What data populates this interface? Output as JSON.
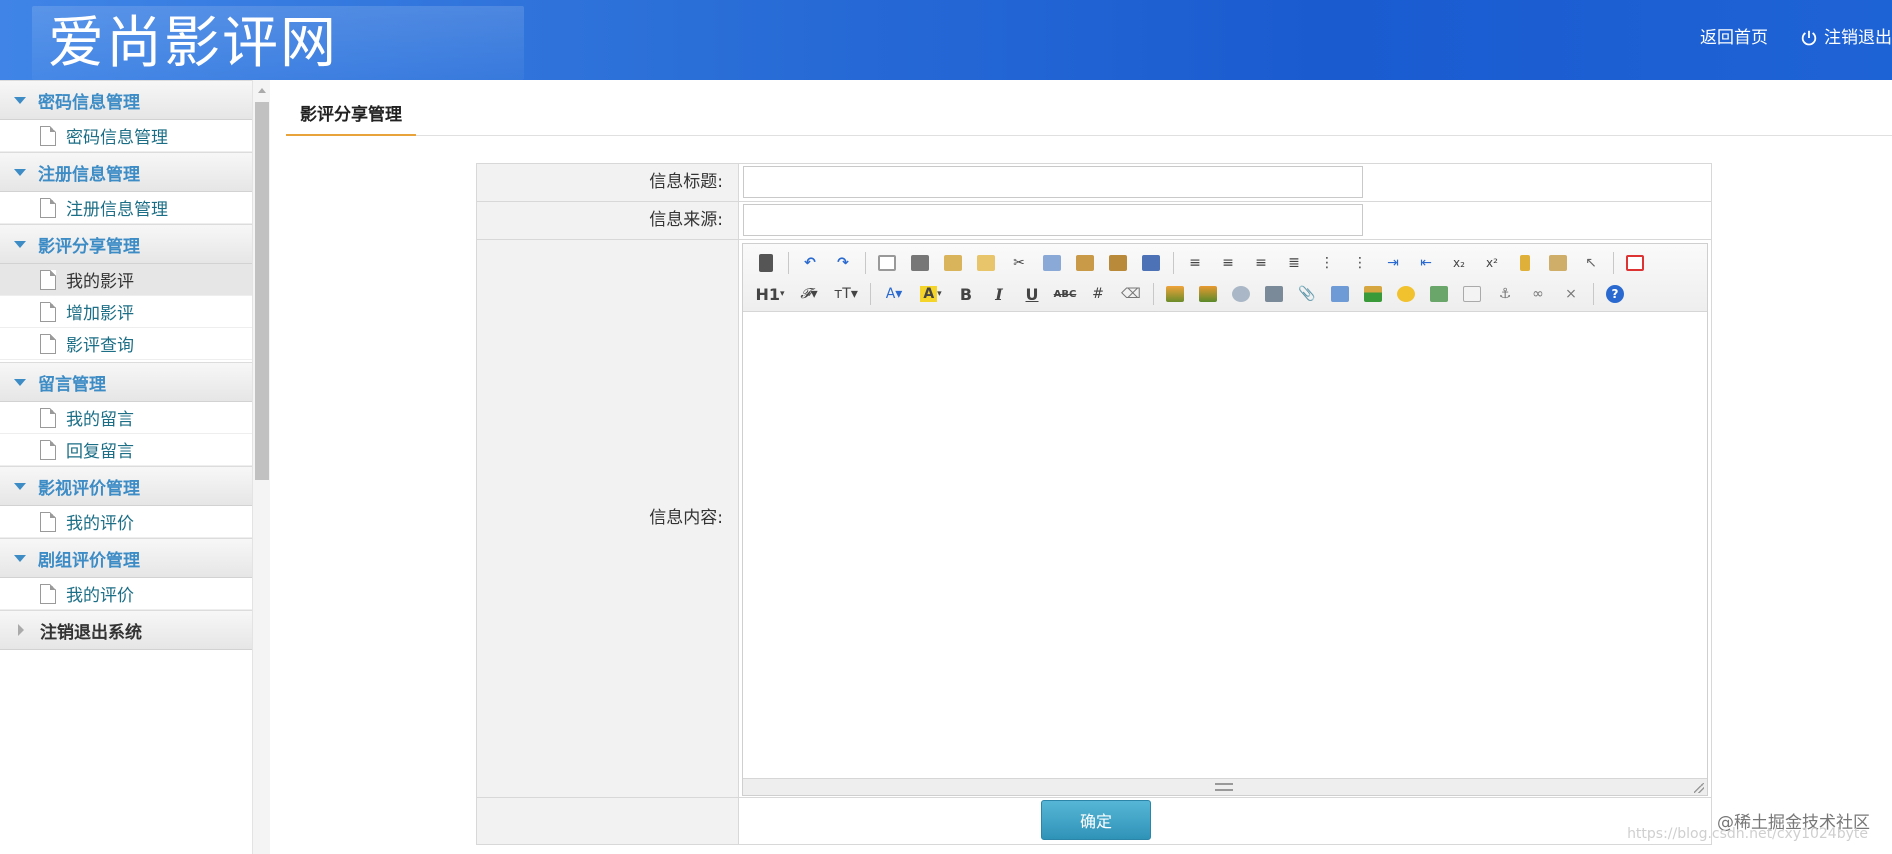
{
  "header": {
    "logo_text": "爱尚影评网",
    "nav_home": "返回首页",
    "nav_logout": "注销退出",
    "gradient_colors": [
      "#3f84e6",
      "#1a5bd0"
    ]
  },
  "sidebar": {
    "groups": [
      {
        "title": "密码信息管理",
        "items": [
          {
            "label": "密码信息管理"
          }
        ]
      },
      {
        "title": "注册信息管理",
        "items": [
          {
            "label": "注册信息管理"
          }
        ]
      },
      {
        "title": "影评分享管理",
        "items": [
          {
            "label": "我的影评",
            "active": true
          },
          {
            "label": "增加影评"
          },
          {
            "label": "影评查询"
          }
        ]
      },
      {
        "title": "留言管理",
        "items": [
          {
            "label": "我的留言"
          },
          {
            "label": "回复留言"
          }
        ]
      },
      {
        "title": "影视评价管理",
        "items": [
          {
            "label": "我的评价"
          }
        ]
      },
      {
        "title": "剧组评价管理",
        "items": [
          {
            "label": "我的评价"
          }
        ]
      },
      {
        "title": "注销退出系统",
        "items": []
      }
    ],
    "accent_color": "#3d8cc6"
  },
  "main": {
    "tab_label": "影评分享管理",
    "form": {
      "title_label": "信息标题:",
      "title_value": "",
      "source_label": "信息来源:",
      "source_value": "",
      "content_label": "信息内容:",
      "submit_label": "确定"
    },
    "editor_toolbar": {
      "row1": [
        "source-icon",
        "undo-icon",
        "redo-icon",
        "preview-icon",
        "print-icon",
        "template-icon",
        "code-icon",
        "cut-icon",
        "copy-icon",
        "paste-icon",
        "paste-text-icon",
        "paste-word-icon",
        "align-left-icon",
        "align-center-icon",
        "align-right-icon",
        "align-justify-icon",
        "ordered-list-icon",
        "unordered-list-icon",
        "indent-icon",
        "outdent-icon",
        "subscript-icon",
        "superscript-icon",
        "clear-format-icon",
        "quick-format-icon",
        "select-all-icon",
        "fullscreen-icon"
      ],
      "row2": [
        "heading-icon",
        "font-family-icon",
        "font-size-icon",
        "font-color-icon",
        "highlight-icon",
        "bold-icon",
        "italic-icon",
        "underline-icon",
        "strikethrough-icon",
        "line-height-icon",
        "remove-format-icon",
        "image-icon",
        "multi-image-icon",
        "flash-icon",
        "media-icon",
        "attachment-icon",
        "table-icon",
        "horizontal-rule-icon",
        "emoticon-icon",
        "map-icon",
        "page-break-icon",
        "anchor-icon",
        "link-icon",
        "unlink-icon",
        "help-icon"
      ],
      "heading_text": "H1",
      "bold_text": "B",
      "italic_text": "I",
      "underline_text": "U",
      "strike_text": "ABC"
    }
  },
  "watermark": {
    "text": "@稀土掘金技术社区",
    "url": "https://blog.csdn.net/cxy1024byte"
  }
}
